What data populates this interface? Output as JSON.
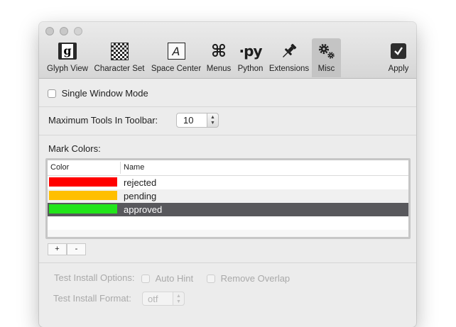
{
  "toolbar": {
    "items": [
      {
        "label": "Glyph View",
        "icon": "glyph-view-icon"
      },
      {
        "label": "Character Set",
        "icon": "checkerboard-icon"
      },
      {
        "label": "Space Center",
        "icon": "space-center-icon"
      },
      {
        "label": "Menus",
        "icon": "command-key-icon"
      },
      {
        "label": "Python",
        "icon": "python-icon"
      },
      {
        "label": "Extensions",
        "icon": "pushpin-icon"
      },
      {
        "label": "Misc",
        "icon": "gears-icon"
      },
      {
        "label": "Apply",
        "icon": "apply-checkmark-icon"
      }
    ],
    "glyphs": {
      "glyph": "g",
      "space": "A",
      "menus": "⌘",
      "python": "·py"
    },
    "selected": "Misc"
  },
  "misc": {
    "single_window_label": "Single Window Mode",
    "single_window_checked": false,
    "max_tools_label": "Maximum Tools In Toolbar:",
    "max_tools_value": "10",
    "mark_colors_label": "Mark Colors:",
    "table": {
      "headers": [
        "Color",
        "Name"
      ],
      "rows": [
        {
          "color": "#ff0000",
          "name": "rejected",
          "selected": false
        },
        {
          "color": "#ffbf00",
          "name": "pending",
          "selected": false
        },
        {
          "color": "#22e51a",
          "name": "approved",
          "selected": true
        }
      ]
    },
    "add_label": "+",
    "remove_label": "-",
    "test_install_options_label": "Test Install Options:",
    "auto_hint_label": "Auto Hint",
    "remove_overlap_label": "Remove Overlap",
    "test_install_format_label": "Test  Install  Format:",
    "test_install_format_value": "otf"
  }
}
